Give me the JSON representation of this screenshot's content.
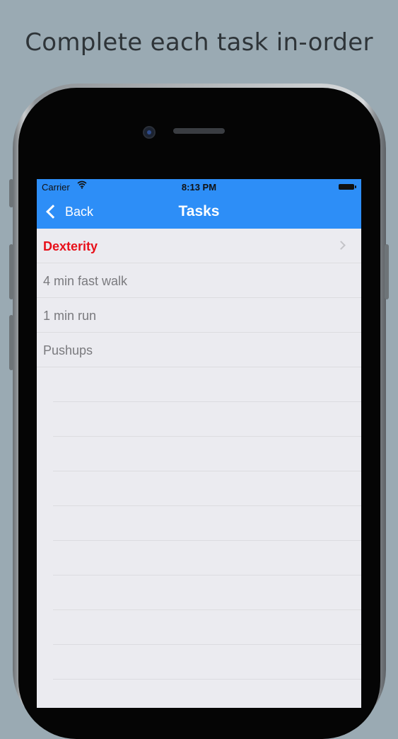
{
  "headline": "Complete each task in-order",
  "status_bar": {
    "carrier": "Carrier",
    "time": "8:13 PM"
  },
  "nav": {
    "back_label": "Back",
    "title": "Tasks"
  },
  "tasks": [
    {
      "label": "Dexterity",
      "active": true
    },
    {
      "label": "4 min fast walk",
      "active": false
    },
    {
      "label": "1 min run",
      "active": false
    },
    {
      "label": "Pushups",
      "active": false
    }
  ],
  "colors": {
    "accent": "#2d8ef7",
    "active_task": "#e8101a",
    "background": "#9aaab3"
  }
}
